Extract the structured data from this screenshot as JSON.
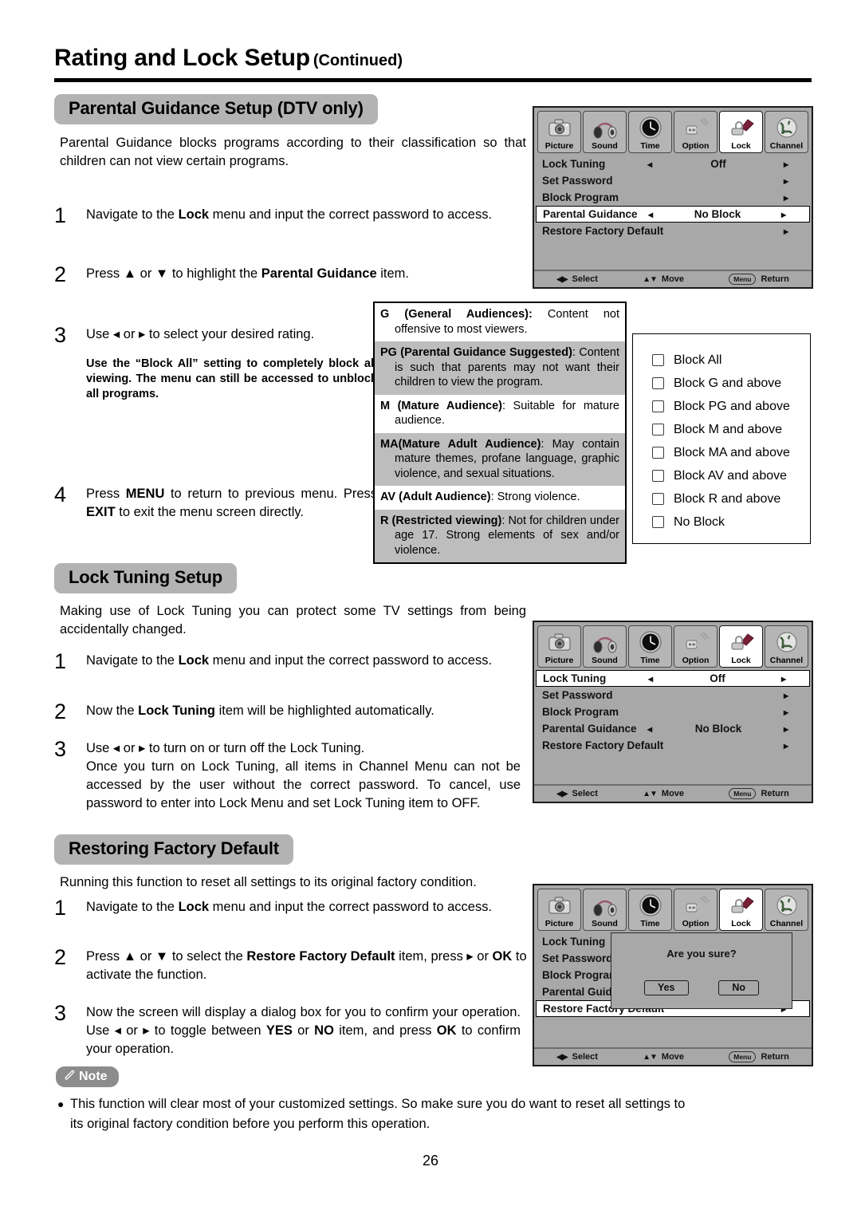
{
  "header": {
    "title": "Rating and Lock Setup",
    "continued": "(Continued)"
  },
  "sections": {
    "parental": {
      "heading": "Parental Guidance Setup (DTV only)",
      "intro": "Parental Guidance blocks programs according to their classification so that children can not view certain programs.",
      "steps": [
        {
          "num": "1",
          "text_pre": "Navigate to the ",
          "bold": "Lock",
          "text_post": " menu and input the correct password to access."
        },
        {
          "num": "2",
          "text_pre": "Press ▲ or ▼ to highlight the ",
          "bold": "Parental Guidance",
          "text_post": " item."
        },
        {
          "num": "3",
          "text_pre": "Use ◂ or ▸ to  select  your  desired rating.",
          "bold": "",
          "text_post": ""
        },
        {
          "num": "4",
          "text_pre": "Press ",
          "bold": "MENU",
          "text_post": " to return to previous menu. Press ",
          "bold2": "EXIT",
          "text_post2": " to exit the menu screen directly."
        }
      ],
      "substep_note": "Use the “Block All” setting to completely block all viewing. The menu can still be accessed to unblock all programs."
    },
    "lock_tuning": {
      "heading": "Lock Tuning Setup",
      "intro": "Making use of Lock Tuning you can protect some TV settings from being accidentally changed.",
      "steps": [
        {
          "num": "1",
          "text_pre": "Navigate to the ",
          "bold": "Lock",
          "text_post": " menu and input the correct password to access."
        },
        {
          "num": "2",
          "text_pre": "Now the ",
          "bold": "Lock Tuning",
          "text_post": " item will be highlighted automatically."
        },
        {
          "num": "3",
          "text_pre": "Use ◂ or ▸ to turn on or turn off the Lock Tuning.\nOnce you turn on Lock Tuning, all items in Channel Menu can not be accessed by the user without the correct password. To cancel, use password to enter into Lock Menu and set Lock Tuning item to OFF.",
          "bold": "",
          "text_post": ""
        }
      ]
    },
    "restore": {
      "heading": "Restoring Factory Default",
      "intro": "Running this function to reset all settings to its original factory condition.",
      "steps": [
        {
          "num": "1",
          "text_pre": "Navigate to the ",
          "bold": "Lock",
          "text_post": " menu and input the correct password to access."
        },
        {
          "num": "2",
          "text_pre": "Press ▲ or ▼ to select the ",
          "bold": "Restore Factory Default",
          "text_post": " item, press ▸ or ",
          "bold2": "OK",
          "text_post2": " to activate the function."
        },
        {
          "num": "3",
          "text_pre": "Now the screen will display a dialog box for you to confirm your operation. Use ◂ or ▸ to toggle between ",
          "bold": "YES",
          "text_mid": " or ",
          "bold2": "NO",
          "text_post2": " item, and press ",
          "bold3": "OK",
          "text_post3": " to confirm your operation."
        }
      ]
    }
  },
  "note": {
    "label": "Note",
    "icon": "pen-icon",
    "text": "This function will clear most of your customized settings.  So make sure you do want to reset all settings to its original factory condition before you perform this operation."
  },
  "rating_table": [
    {
      "code": "G",
      "title": "(General Audiences):",
      "desc": " Content not offensive to most viewers.",
      "shaded": false
    },
    {
      "code": "PG",
      "title": "(Parental Guidance Suggested)",
      "desc": ": Content is such that parents may not want their children to view the program.",
      "shaded": true
    },
    {
      "code": "M",
      "title": "(Mature Audience)",
      "desc": ": Suitable for mature audience.",
      "shaded": false
    },
    {
      "code": "MA",
      "title": "(Mature Adult Audience)",
      "desc": ": May contain mature themes, profane language, graphic violence, and sexual situations.",
      "shaded": true
    },
    {
      "code": "AV",
      "title": "(Adult Audience)",
      "desc": ": Strong violence.",
      "shaded": false
    },
    {
      "code": "R",
      "title": "(Restricted viewing)",
      "desc": ": Not for children under age 17. Strong elements of sex and/or violence.",
      "shaded": true
    }
  ],
  "block_options": [
    "Block All",
    "Block G and above",
    "Block PG and above",
    "Block M and above",
    "Block MA and above",
    "Block AV and above",
    "Block R and above",
    "No Block"
  ],
  "osd": {
    "tabs": [
      {
        "label": "Picture",
        "icon": "camera-icon"
      },
      {
        "label": "Sound",
        "icon": "headphones-icon"
      },
      {
        "label": "Time",
        "icon": "clock-icon"
      },
      {
        "label": "Option",
        "icon": "plug-icon"
      },
      {
        "label": "Lock",
        "icon": "padlock-icon"
      },
      {
        "label": "Channel",
        "icon": "globe-icon"
      }
    ],
    "active_tab": "Lock",
    "footer": [
      {
        "keys": "◀▶",
        "label": "Select"
      },
      {
        "keys": "▲▼",
        "label": "Move"
      },
      {
        "keys": "Menu",
        "label": "Return",
        "is_cap": true
      }
    ],
    "screen1": {
      "rows": [
        {
          "name": "Lock Tuning",
          "left": "◂",
          "value": "Off",
          "right": "▸",
          "selected": false
        },
        {
          "name": "Set Password",
          "left": "",
          "value": "",
          "right": "▸",
          "selected": false
        },
        {
          "name": "Block Program",
          "left": "",
          "value": "",
          "right": "▸",
          "selected": false
        },
        {
          "name": "Parental Guidance",
          "left": "◂",
          "value": "No Block",
          "right": "▸",
          "selected": true
        },
        {
          "name": "Restore Factory Default",
          "left": "",
          "value": "",
          "right": "▸",
          "selected": false
        }
      ]
    },
    "screen2": {
      "rows": [
        {
          "name": "Lock Tuning",
          "left": "◂",
          "value": "Off",
          "right": "▸",
          "selected": true
        },
        {
          "name": "Set Password",
          "left": "",
          "value": "",
          "right": "▸",
          "selected": false
        },
        {
          "name": "Block Program",
          "left": "",
          "value": "",
          "right": "▸",
          "selected": false
        },
        {
          "name": "Parental Guidance",
          "left": "◂",
          "value": "No Block",
          "right": "▸",
          "selected": false
        },
        {
          "name": "Restore Factory Default",
          "left": "",
          "value": "",
          "right": "▸",
          "selected": false
        }
      ]
    },
    "screen3": {
      "rows": [
        {
          "name": "Lock Tuning",
          "left": "",
          "value": "",
          "right": "",
          "selected": false
        },
        {
          "name": "Set Password",
          "left": "",
          "value": "",
          "right": "",
          "selected": false
        },
        {
          "name": "Block Program",
          "left": "",
          "value": "",
          "right": "",
          "selected": false
        },
        {
          "name": "Parental Guidance",
          "left": "",
          "value": "",
          "right": "",
          "selected": false
        },
        {
          "name": "Restore Factory Default",
          "left": "",
          "value": "",
          "right": "▸",
          "selected": true
        }
      ],
      "dialog": {
        "title": "Are you sure?",
        "yes": "Yes",
        "no": "No"
      }
    }
  },
  "page_number": "26"
}
